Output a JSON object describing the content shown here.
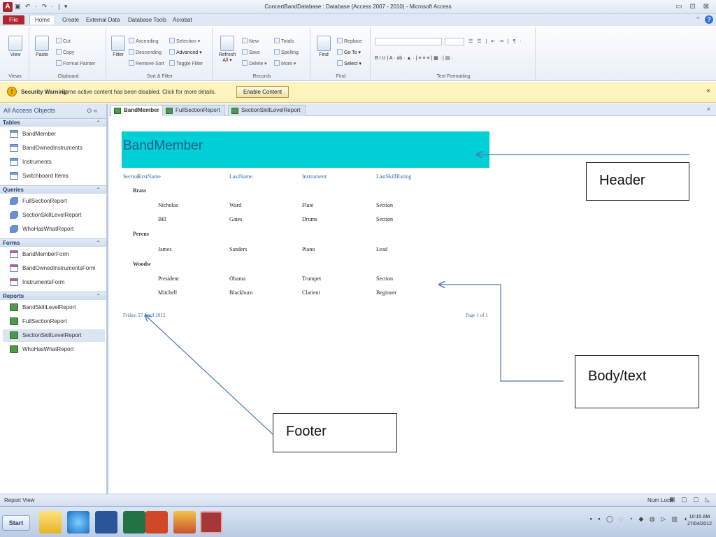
{
  "window": {
    "app_icon": "A",
    "quick_access": "▣ ↶ · ↷ · | ▾",
    "title": "ConcertBandDatabase : Database (Access 2007 - 2010) - Microsoft Access",
    "controls": "▭ ⊡ ⊠"
  },
  "ribbon_tabs": [
    "File",
    "Home",
    "Create",
    "External Data",
    "Database Tools",
    "Acrobat"
  ],
  "ribbon": {
    "views": {
      "view": "View",
      "label": "Views"
    },
    "clipboard": {
      "paste": "Paste",
      "cut": "Cut",
      "copy": "Copy",
      "format_painter": "Format Painter",
      "label": "Clipboard"
    },
    "sort_filter": {
      "filter": "Filter",
      "ascending": "Ascending",
      "descending": "Descending",
      "remove_sort": "Remove Sort",
      "selection": "Selection ▾",
      "advanced": "Advanced ▾",
      "toggle_filter": "Toggle Filter",
      "label": "Sort & Filter"
    },
    "records": {
      "refresh": "Refresh All ▾",
      "new": "New",
      "save": "Save",
      "delete": "Delete ▾",
      "totals": "Totals",
      "spelling": "Spelling",
      "more": "More ▾",
      "label": "Records"
    },
    "find": {
      "find": "Find",
      "replace": "Replace",
      "go_to": "Go To ▾",
      "select": "Select ▾",
      "label": "Find"
    },
    "text_formatting": {
      "format_row": "B  I  U  |  A ·  ab ·  ▲ ·  |  ≡  ≡  ≡  |  ▦ ·  |  ▤ ·",
      "label": "Text Formatting"
    }
  },
  "security": {
    "title": "Security Warning",
    "message": "Some active content has been disabled. Click for more details.",
    "button": "Enable Content",
    "close": "×"
  },
  "nav": {
    "header": "All Access Objects",
    "header_icons": "⊙ «",
    "sections": [
      {
        "label": "Tables",
        "items": [
          {
            "label": "BandMember"
          },
          {
            "label": "BandOwnedInstruments"
          },
          {
            "label": "Instruments"
          },
          {
            "label": "Switchboard Items"
          }
        ]
      },
      {
        "label": "Queries",
        "items": [
          {
            "label": "FullSectionReport"
          },
          {
            "label": "SectionSkillLevelReport"
          },
          {
            "label": "WhoHasWhatReport"
          }
        ]
      },
      {
        "label": "Forms",
        "items": [
          {
            "label": "BandMemberForm"
          },
          {
            "label": "BandOwnedInstrumentsForm"
          },
          {
            "label": "InstrumentsForm"
          }
        ]
      },
      {
        "label": "Reports",
        "items": [
          {
            "label": "BandSkillLevelReport"
          },
          {
            "label": "FullSectionReport"
          },
          {
            "label": "SectionSkillLevelReport"
          },
          {
            "label": "WhoHasWhatReport"
          }
        ]
      }
    ],
    "collapse_glyph": "⌃"
  },
  "doc_tabs": [
    "BandMember",
    "FullSectionReport",
    "SectionSkillLevelReport"
  ],
  "doc_close": "×",
  "report": {
    "title": "BandMember",
    "columns": [
      "Section",
      "FirstName",
      "LastName",
      "Instrument",
      "LastSkillRating"
    ],
    "groups": [
      {
        "name": "Brass",
        "rows": [
          [
            "Nicholas",
            "Ward",
            "Flute",
            "Section"
          ],
          [
            "Bill",
            "Gates",
            "Drums",
            "Section"
          ]
        ]
      },
      {
        "name": "Percus",
        "rows": [
          [
            "James",
            "Sanders",
            "Piano",
            "Lead"
          ]
        ]
      },
      {
        "name": "Woodw",
        "rows": [
          [
            "President",
            "Obama",
            "Trumpet",
            "Section"
          ],
          [
            "Mitchell",
            "Blackburn",
            "Clarient",
            "Beginner"
          ]
        ]
      }
    ],
    "footer_date": "Friday, 27 April 2012",
    "footer_page": "Page 1 of 1"
  },
  "callouts": {
    "header": "Header",
    "body": "Body/text",
    "footer": "Footer"
  },
  "status": {
    "left": "Report View",
    "num_lock": "Num Lock"
  },
  "taskbar": {
    "start": "Start",
    "tray": "▪ ▪ ◯ ◌ ◔ ◆ ◍ ▷ ▥ ◖",
    "time": "10:15 AM",
    "date": "27/04/2012"
  },
  "colors": {
    "header_band": "#00cfd5",
    "accent_blue": "#2d6c9e",
    "file_tab": "#b3252e",
    "warning_bar": "#fff4be",
    "callout_line": "#4a78b8"
  }
}
